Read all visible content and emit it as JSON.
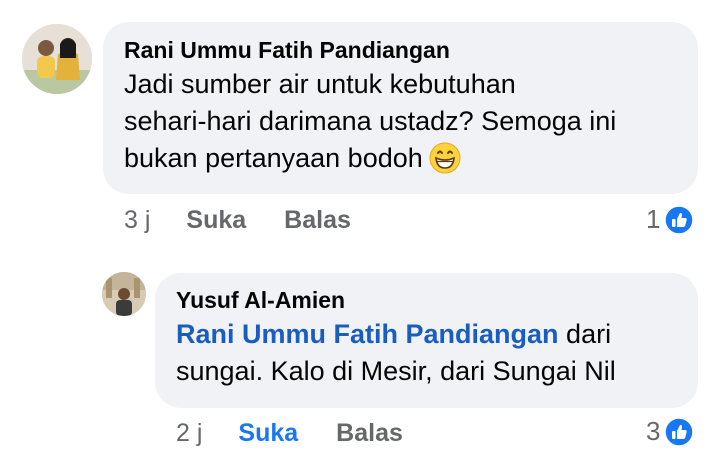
{
  "comments": [
    {
      "author": "Rani Ummu Fatih Pandiangan",
      "text_lines": [
        "Jadi sumber air untuk kebutuhan",
        "sehari-hari darimana ustadz? Semoga ini",
        "bukan pertanyaan bodoh"
      ],
      "emoji": "grinning-face-emoji",
      "time": "3 j",
      "like_label": "Suka",
      "reply_label": "Balas",
      "reaction_count": "1"
    },
    {
      "author": "Yusuf Al-Amien",
      "mention": "Rani Ummu Fatih Pandiangan",
      "text_after_mention": " dari",
      "text_line2": "sungai. Kalo di Mesir, dari Sungai Nil",
      "time": "2 j",
      "like_label": "Suka",
      "reply_label": "Balas",
      "reaction_count": "3"
    }
  ],
  "colors": {
    "bubble": "#f0f2f5",
    "mention": "#1b5dbf",
    "like_active": "#1877f2",
    "meta": "#65676b"
  }
}
